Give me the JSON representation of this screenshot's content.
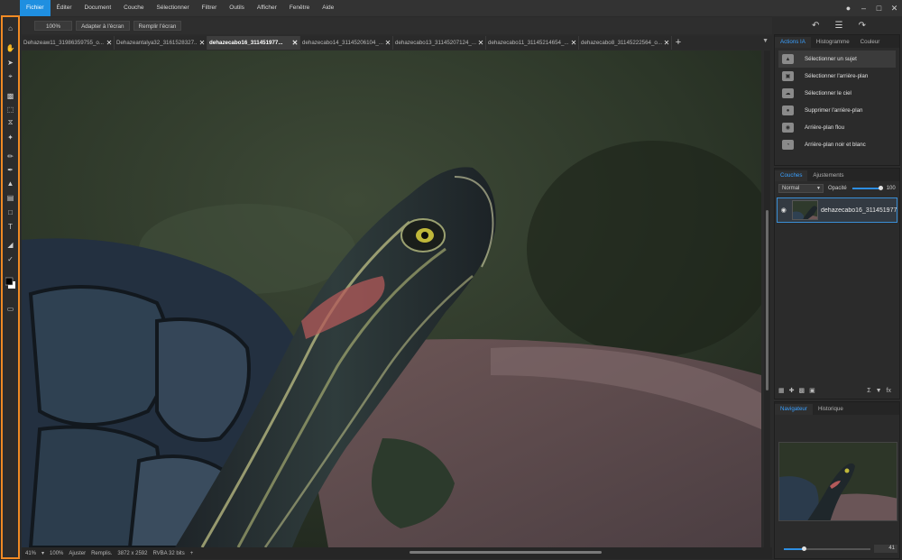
{
  "menubar": {
    "items": [
      "Fichier",
      "Éditer",
      "Document",
      "Couche",
      "Sélectionner",
      "Filtrer",
      "Outils",
      "Afficher",
      "Fenêtre",
      "Aide"
    ],
    "active_index": 0
  },
  "context_toolbar": {
    "zoom_label": "100%",
    "fit_label": "Adapter à l'écran",
    "fill_label": "Remplir l'écran"
  },
  "tabs": [
    {
      "label": "Dehazeaw11_31986359755_o..."
    },
    {
      "label": "Dehazeantalya32_3161528327..."
    },
    {
      "label": "dehazecabo16_311451977..."
    },
    {
      "label": "dehazecabo14_31145206104_..."
    },
    {
      "label": "dehazecabo13_31145207124_..."
    },
    {
      "label": "dehazecabo11_31145214654_..."
    },
    {
      "label": "dehazecabo8_31145222564_o..."
    }
  ],
  "active_tab": 2,
  "statusbar": {
    "zoom": "41%",
    "zoom2": "100%",
    "fit": "Ajuster",
    "fill": "Remplis.",
    "dimensions": "3872 x 2592",
    "mode": "RVBA 32 bits"
  },
  "ai_panel": {
    "tabs": [
      "Actions IA",
      "Histogramme",
      "Couleur"
    ],
    "items": [
      "Sélectionner un sujet",
      "Sélectionner l'arrière-plan",
      "Sélectionner le ciel",
      "Supprimer l'arrière-plan",
      "Arrière-plan flou",
      "Arrière-plan noir et blanc"
    ]
  },
  "layers_panel": {
    "tabs": [
      "Couches",
      "Ajustements"
    ],
    "blend_mode": "Normal",
    "opacity_label": "Opacité",
    "opacity_value": "100",
    "layer_name": "dehazecabo16_311451977..."
  },
  "navigator_panel": {
    "tabs": [
      "Navigateur",
      "Historique"
    ],
    "zoom_value": "41"
  },
  "colors": {
    "accent": "#1f8fe0",
    "toolbar_border": "#f08a24",
    "active_tab_text": "#3aa0ff"
  },
  "icons": [
    "home-icon",
    "hand-icon",
    "arrow-icon",
    "crop-icon",
    "clone-icon",
    "marquee-icon",
    "lasso-icon",
    "magic-wand-icon",
    "eyedropper-icon",
    "brush-icon",
    "fill-icon",
    "gradient-icon",
    "rectangle-icon",
    "text-icon",
    "eraser-icon",
    "pen-icon",
    "color-swatch-icon"
  ]
}
